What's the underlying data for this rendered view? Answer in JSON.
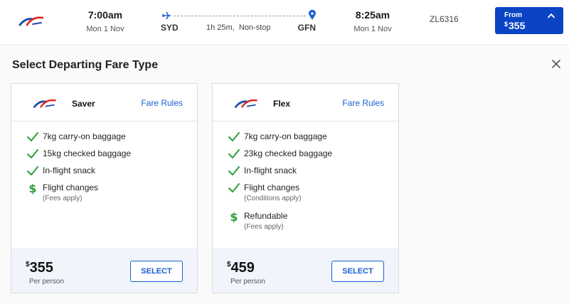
{
  "flight": {
    "airline_logo": "rex",
    "departure_time": "7:00am",
    "departure_date": "Mon 1 Nov",
    "origin": "SYD",
    "duration": "1h 25m,",
    "stops": "Non-stop",
    "destination": "GFN",
    "arrival_time": "8:25am",
    "arrival_date": "Mon 1 Nov",
    "flight_number": "ZL6316",
    "from_label": "From",
    "from_currency": "$",
    "from_price": "355"
  },
  "panel": {
    "title": "Select Departing Fare Type"
  },
  "fares": [
    {
      "logo": "rex",
      "name": "Saver",
      "rules_label": "Fare Rules",
      "features": [
        {
          "icon": "check-icon",
          "text": "7kg carry-on baggage"
        },
        {
          "icon": "check-icon",
          "text": "15kg checked baggage"
        },
        {
          "icon": "check-icon",
          "text": "In-flight snack"
        },
        {
          "icon": "dollar-icon",
          "text": "Flight changes",
          "note": "(Fees apply)"
        }
      ],
      "currency": "$",
      "price": "355",
      "per_label": "Per person",
      "select_label": "SELECT"
    },
    {
      "logo": "rex",
      "name": "Flex",
      "rules_label": "Fare Rules",
      "features": [
        {
          "icon": "check-icon",
          "text": "7kg carry-on baggage"
        },
        {
          "icon": "check-icon",
          "text": "23kg checked baggage"
        },
        {
          "icon": "check-icon",
          "text": "In-flight snack"
        },
        {
          "icon": "check-icon",
          "text": "Flight changes",
          "note": "(Conditions apply)"
        },
        {
          "icon": "dollar-icon",
          "text": "Refundable",
          "note": "(Fees apply)"
        }
      ],
      "currency": "$",
      "price": "459",
      "per_label": "Per person",
      "select_label": "SELECT"
    }
  ],
  "colors": {
    "primary": "#0a43c4",
    "link": "#1a5fd0",
    "check": "#2e9e3a",
    "logo_red": "#e2231a",
    "logo_blue": "#1f4fa8"
  }
}
